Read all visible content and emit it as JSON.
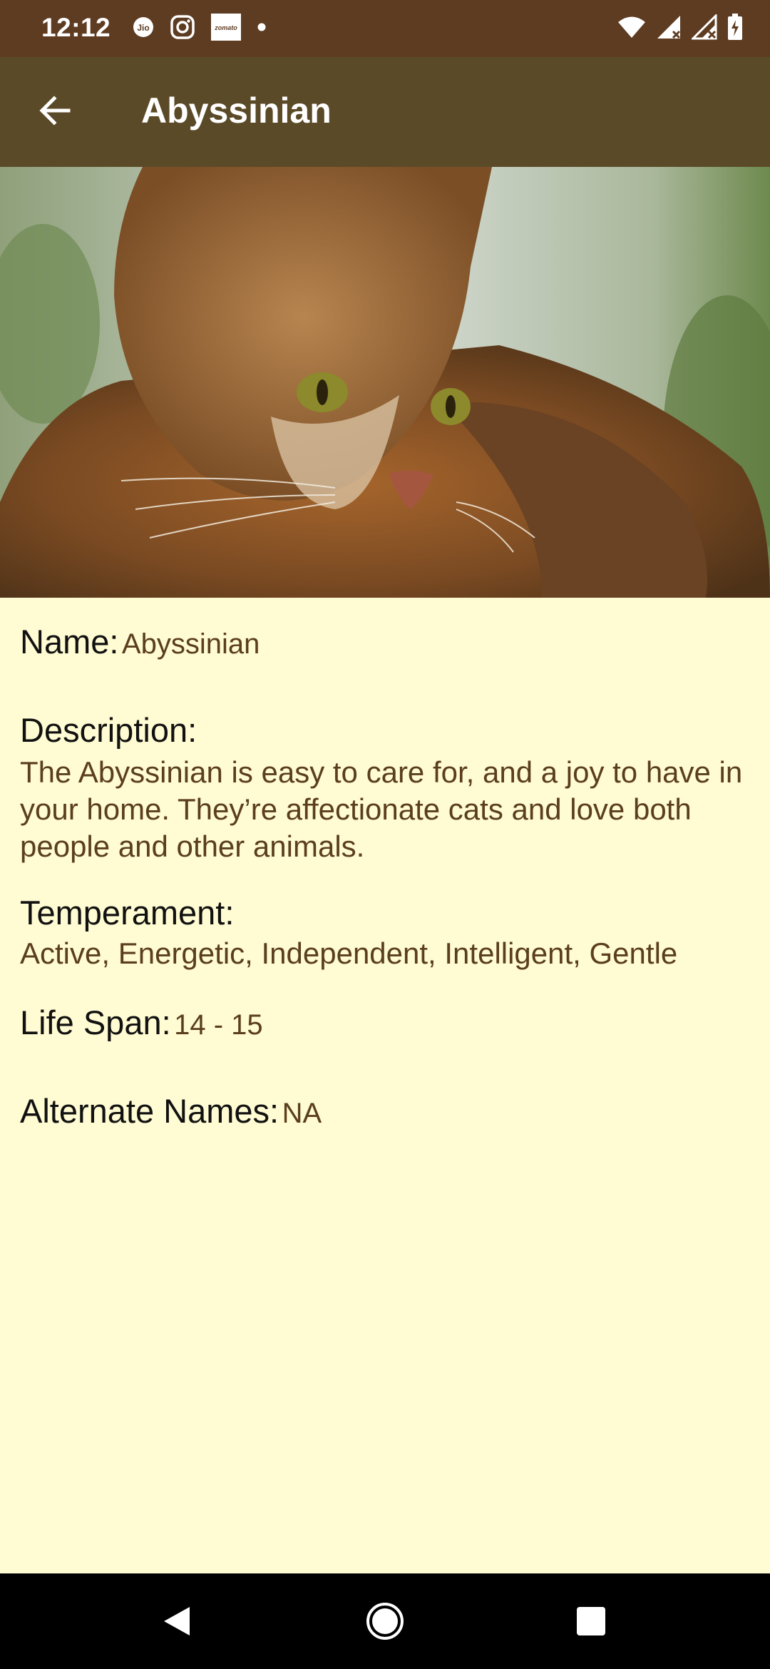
{
  "status_bar": {
    "time": "12:12",
    "left_icons": [
      "jio-icon",
      "instagram-icon",
      "zomato-icon",
      "dot-icon"
    ],
    "zomato_text": "zomato",
    "right_icons": [
      "wifi-icon",
      "signal-icon",
      "signal-icon",
      "battery-icon"
    ]
  },
  "app_bar": {
    "back_icon": "arrow-left-icon",
    "title": "Abyssinian"
  },
  "hero_image": {
    "subject": "cat-photo"
  },
  "details": {
    "name_label": "Name:",
    "name_value": "Abyssinian",
    "description_label": "Description:",
    "description_value": "The Abyssinian is easy to care for, and a joy to have in your home. They’re affectionate cats and love both people and other animals.",
    "temperament_label": "Temperament:",
    "temperament_value": "Active, Energetic, Independent, Intelligent, Gentle",
    "life_span_label": "Life Span:",
    "life_span_value": "14 - 15",
    "alternate_names_label": "Alternate Names:",
    "alternate_names_value": "NA"
  },
  "nav_bar": {
    "icons": [
      "back-triangle-icon",
      "home-circle-icon",
      "recents-square-icon"
    ]
  },
  "colors": {
    "status_bar": "#5E3C22",
    "app_bar": "#5B4A28",
    "background": "#FFFBD2",
    "value_text": "#5A3E1E"
  }
}
